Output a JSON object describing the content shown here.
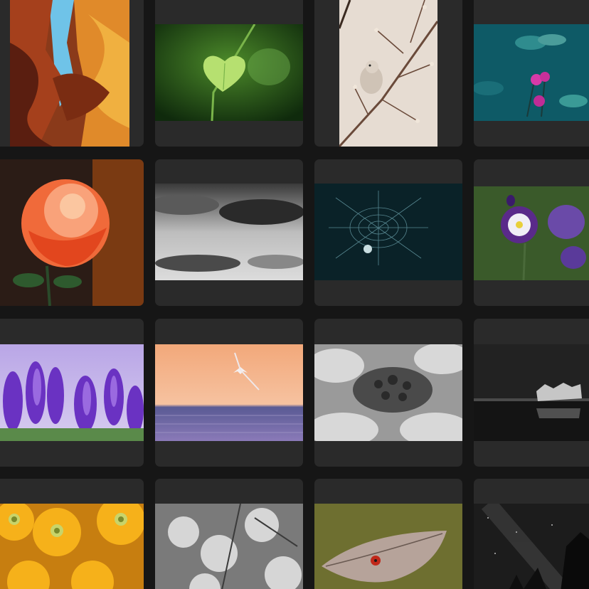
{
  "gallery": {
    "photos": [
      {
        "row": 0,
        "col": 0,
        "subject": "canyon"
      },
      {
        "row": 0,
        "col": 1,
        "subject": "leaf"
      },
      {
        "row": 0,
        "col": 2,
        "subject": "bird-branch"
      },
      {
        "row": 0,
        "col": 3,
        "subject": "lotus-pond"
      },
      {
        "row": 1,
        "col": 0,
        "subject": "rose"
      },
      {
        "row": 1,
        "col": 1,
        "subject": "clouds"
      },
      {
        "row": 1,
        "col": 2,
        "subject": "spiderweb"
      },
      {
        "row": 1,
        "col": 3,
        "subject": "columbine"
      },
      {
        "row": 2,
        "col": 0,
        "subject": "crocus"
      },
      {
        "row": 2,
        "col": 1,
        "subject": "seagull-sunset"
      },
      {
        "row": 2,
        "col": 2,
        "subject": "tortoise"
      },
      {
        "row": 2,
        "col": 3,
        "subject": "splash"
      },
      {
        "row": 3,
        "col": 0,
        "subject": "yellow-daisies"
      },
      {
        "row": 3,
        "col": 1,
        "subject": "blossoms"
      },
      {
        "row": 3,
        "col": 2,
        "subject": "ladybug-leaf"
      },
      {
        "row": 3,
        "col": 3,
        "subject": "night-sky"
      }
    ]
  },
  "colors": {
    "background": "#161616",
    "card": "#2a2a2a"
  }
}
